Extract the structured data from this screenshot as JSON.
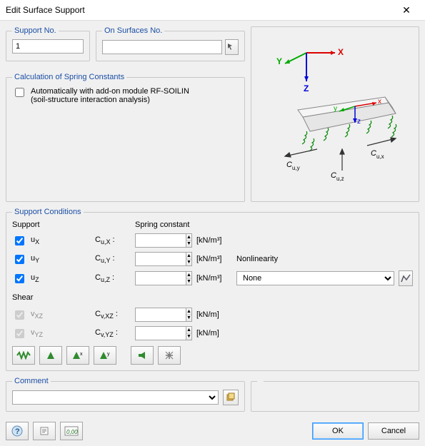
{
  "window": {
    "title": "Edit Surface Support"
  },
  "supportNo": {
    "legend": "Support No.",
    "value": "1"
  },
  "onSurfaces": {
    "legend": "On Surfaces No.",
    "value": ""
  },
  "springCalc": {
    "legend": "Calculation of Spring Constants",
    "checkboxLabel": "Automatically with add-on module RF-SOILIN",
    "checkboxSub": "(soil-structure interaction analysis)",
    "checked": false
  },
  "conditions": {
    "legend": "Support Conditions",
    "supportHeader": "Support",
    "springHeader": "Spring constant",
    "shearHeader": "Shear",
    "nonlinLabel": "Nonlinearity",
    "nonlinValue": "None",
    "rows": {
      "ux": {
        "label": "uX",
        "coef": "Cu,X :",
        "value": "",
        "unit": "[kN/m³]",
        "checked": true,
        "enabled": true
      },
      "uy": {
        "label": "uY",
        "coef": "Cu,Y :",
        "value": "",
        "unit": "[kN/m³]",
        "checked": true,
        "enabled": true
      },
      "uz": {
        "label": "uZ",
        "coef": "Cu,Z :",
        "value": "",
        "unit": "[kN/m³]",
        "checked": true,
        "enabled": true
      },
      "vxz": {
        "label": "vXZ",
        "coef": "Cv,XZ :",
        "value": "",
        "unit": "[kN/m]",
        "checked": true,
        "enabled": false
      },
      "vyz": {
        "label": "vYZ",
        "coef": "Cv,YZ :",
        "value": "",
        "unit": "[kN/m]",
        "checked": true,
        "enabled": false
      }
    }
  },
  "comment": {
    "legend": "Comment",
    "value": ""
  },
  "buttons": {
    "ok": "OK",
    "cancel": "Cancel"
  }
}
